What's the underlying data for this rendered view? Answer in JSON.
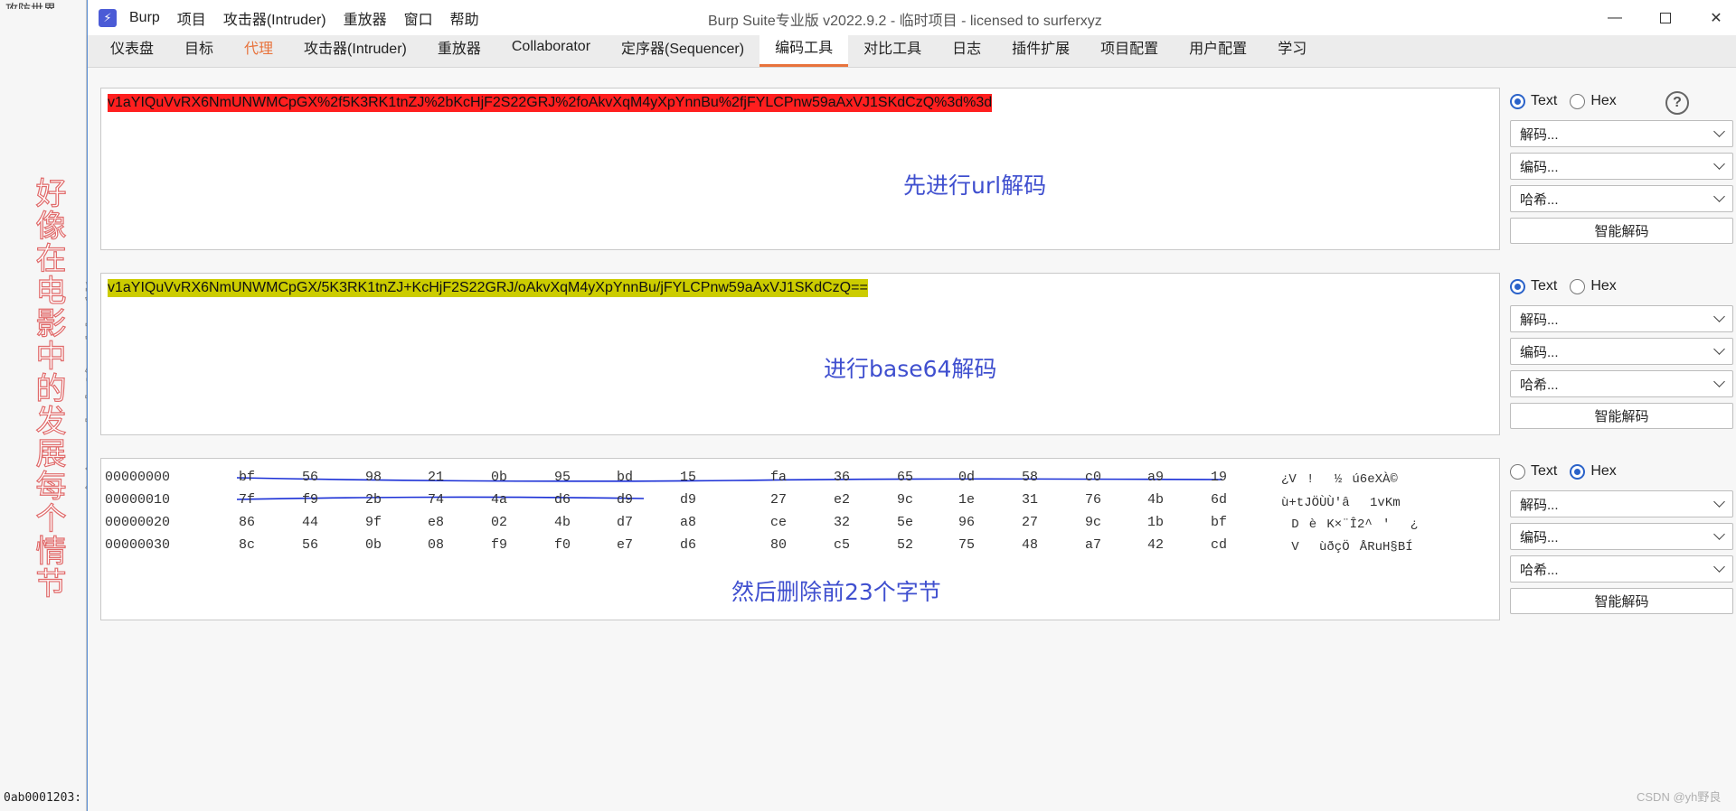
{
  "background": {
    "top_text": "攻防世界",
    "bottom_text": "0ab0001203:"
  },
  "annotations": {
    "left_red": "好像在电影中的发展每个情节",
    "left_gray": "我最后再说几句",
    "note1": "先进行url解码",
    "note2": "进行base64解码",
    "note3": "然后删除前23个字节"
  },
  "titlebar": {
    "menu": [
      "Burp",
      "项目",
      "攻击器(Intruder)",
      "重放器",
      "窗口",
      "帮助"
    ],
    "title": "Burp Suite专业版  v2022.9.2 - 临时项目 - licensed to surferxyz"
  },
  "tabs": [
    "仪表盘",
    "目标",
    "代理",
    "攻击器(Intruder)",
    "重放器",
    "Collaborator",
    "定序器(Sequencer)",
    "编码工具",
    "对比工具",
    "日志",
    "插件扩展",
    "项目配置",
    "用户配置",
    "学习"
  ],
  "panels": {
    "p1_text": "v1aYIQuVvRX6NmUNWMCpGX%2f5K3RK1tnZJ%2bKcHjF2S22GRJ%2foAkvXqM4yXpYnnBu%2fjFYLCPnw59aAxVJ1SKdCzQ%3d%3d",
    "p2_text": "v1aYIQuVvRX6NmUNWMCpGX/5K3RK1tnZJ+KcHjF2S22GRJ/oAkvXqM4yXpYnnBu/jFYLCPnw59aAxVJ1SKdCzQ==",
    "hex_rows": [
      {
        "offset": "00000000",
        "bytes": [
          "bf",
          "56",
          "98",
          "21",
          "0b",
          "95",
          "bd",
          "15",
          "fa",
          "36",
          "65",
          "0d",
          "58",
          "c0",
          "a9",
          "19"
        ],
        "ascii": "¿V!\u000b½\u0015ú6eXÀ©\u0019"
      },
      {
        "offset": "00000010",
        "bytes": [
          "7f",
          "f9",
          "2b",
          "74",
          "4a",
          "d6",
          "d9",
          "d9",
          "27",
          "e2",
          "9c",
          "1e",
          "31",
          "76",
          "4b",
          "6d"
        ],
        "ascii": "ù+tJÖÙÙ'â\u001e1vKm"
      },
      {
        "offset": "00000020",
        "bytes": [
          "86",
          "44",
          "9f",
          "e8",
          "02",
          "4b",
          "d7",
          "a8",
          "ce",
          "32",
          "5e",
          "96",
          "27",
          "9c",
          "1b",
          "bf"
        ],
        "ascii": "Dè\u0002K×¨Î2^'\u001b¿"
      },
      {
        "offset": "00000030",
        "bytes": [
          "8c",
          "56",
          "0b",
          "08",
          "f9",
          "f0",
          "e7",
          "d6",
          "80",
          "c5",
          "52",
          "75",
          "48",
          "a7",
          "42",
          "cd"
        ],
        "ascii": "V\u000b\bùðçÖÅRuH§BÍ"
      }
    ]
  },
  "controls": {
    "text_label": "Text",
    "hex_label": "Hex",
    "decode_label": "解码...",
    "encode_label": "编码...",
    "hash_label": "哈希...",
    "smart_label": "智能解码",
    "help_glyph": "?"
  },
  "watermark": "CSDN @yh野良",
  "colors": {
    "accent": "#e8733c",
    "red_highlight": "#ff1f1f",
    "yellow_highlight": "#cccc00",
    "note_blue": "#3f4fcf",
    "ink_blue": "#1a2fd6"
  }
}
